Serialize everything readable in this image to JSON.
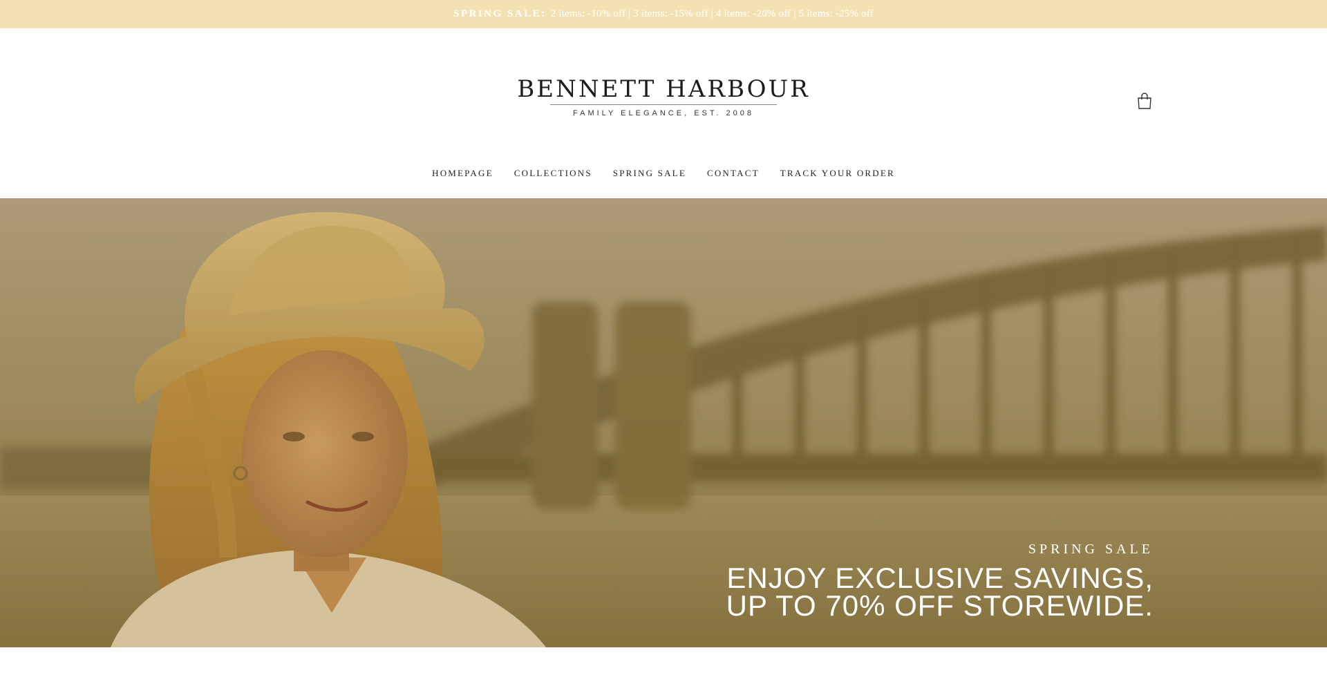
{
  "announcement": {
    "lead": "SPRING SALE:",
    "text": "2 items: -10% off | 3 items: -15% off | 4 items: -20% off | 5 items: -25% off"
  },
  "brand": {
    "name": "BENNETT HARBOUR",
    "tagline": "FAMILY ELEGANCE, EST. 2008"
  },
  "header": {
    "cart_icon": "shopping-bag-icon"
  },
  "nav": {
    "items": [
      {
        "label": "HOMEPAGE"
      },
      {
        "label": "COLLECTIONS"
      },
      {
        "label": "SPRING SALE"
      },
      {
        "label": "CONTACT"
      },
      {
        "label": "TRACK YOUR ORDER"
      }
    ]
  },
  "hero": {
    "eyebrow": "SPRING SALE",
    "title_line1": "ENJOY EXCLUSIVE SAVINGS,",
    "title_line2": "UP TO 70% OFF STOREWIDE."
  },
  "colors": {
    "announcement_bg": "#f2e2b4",
    "hero_tint": "#a08d63",
    "text_dark": "#1c1c1c"
  }
}
